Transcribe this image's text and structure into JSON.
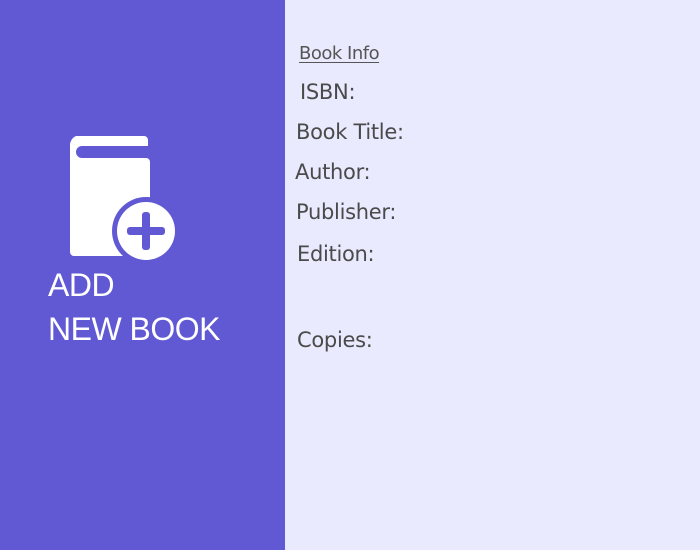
{
  "sidebar": {
    "title_line1": "ADD",
    "title_line2": "NEW BOOK",
    "icon": "book-add-icon",
    "background_color": "#6159d4"
  },
  "form": {
    "section_heading": "Book Info",
    "labels": {
      "isbn": "ISBN:",
      "book_title": "Book Title:",
      "author": "Author:",
      "publisher": "Publisher:",
      "edition": "Edition:",
      "copies": "Copies:"
    },
    "background_color": "#eaeaff"
  }
}
